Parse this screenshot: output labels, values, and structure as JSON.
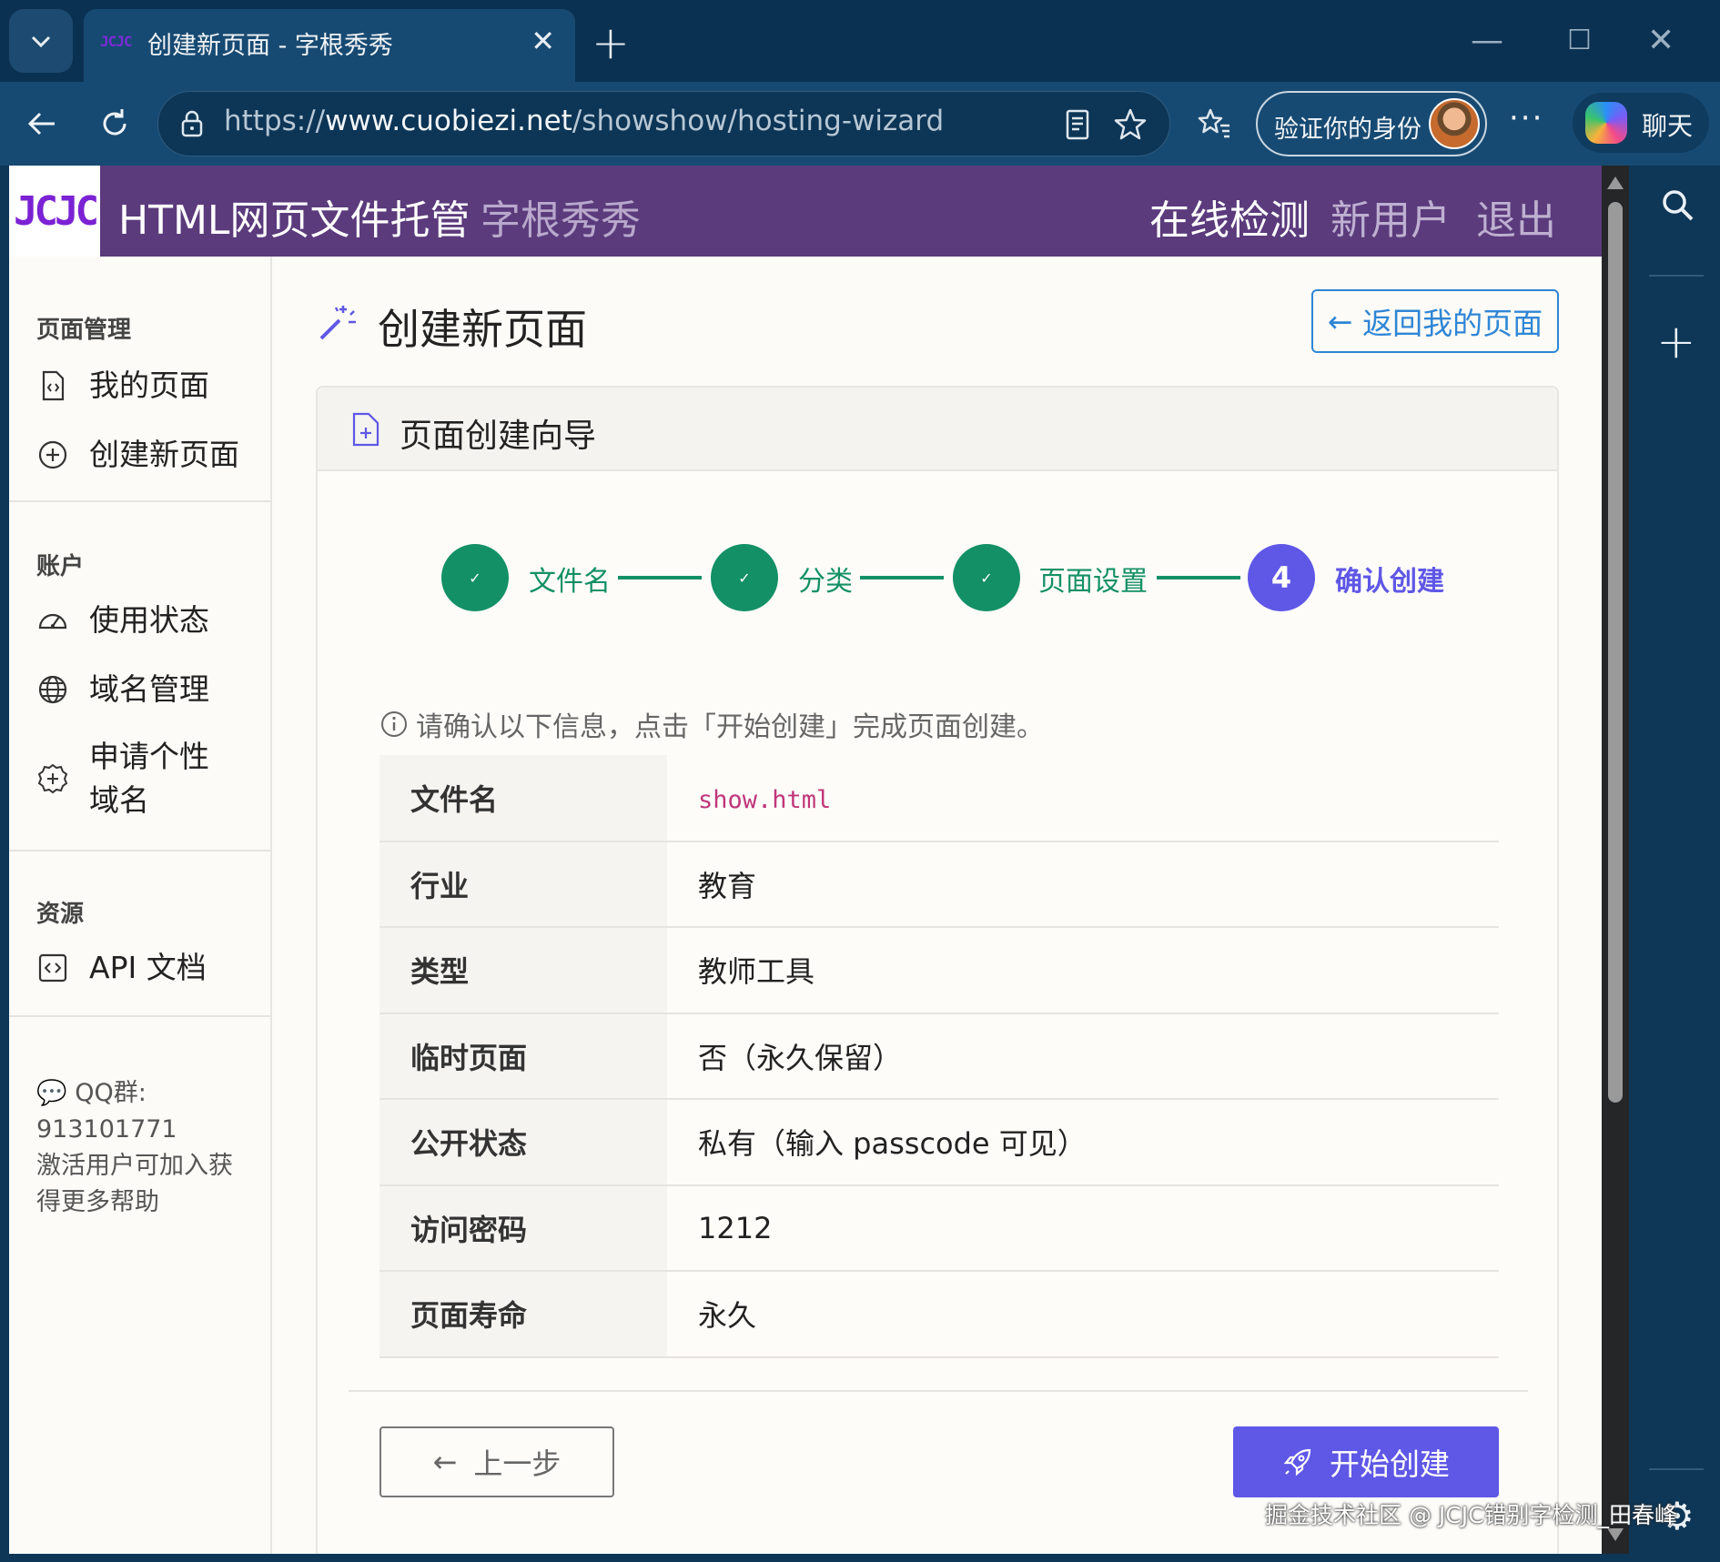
{
  "browser": {
    "tab_title": "创建新页面 - 字根秀秀",
    "tab_favicon": "JCJC",
    "url_scheme": "https://",
    "url_host": "www.cuobiezi.net",
    "url_path": "/showshow/hosting-wizard",
    "verify_label": "验证你的身份",
    "chat_label": "聊天",
    "icons": [
      "tab-list-icon",
      "close-icon",
      "plus-icon",
      "back-arrow-icon",
      "refresh-icon",
      "lock-icon",
      "reader-icon",
      "star-icon",
      "favorites-icon",
      "more-icon",
      "copilot-icon",
      "search-icon",
      "settings-icon"
    ]
  },
  "header": {
    "logo": "JCJC",
    "title": "HTML网页文件托管",
    "subtitle": "字根秀秀",
    "links": [
      "在线检测",
      "新用户",
      "退出"
    ],
    "brand_color": "#5b3b7c"
  },
  "sidebar": {
    "sections": [
      {
        "title": "页面管理",
        "items": [
          {
            "label": "我的页面",
            "icon": "file-code-icon"
          },
          {
            "label": "创建新页面",
            "icon": "plus-circle-icon"
          }
        ]
      },
      {
        "title": "账户",
        "items": [
          {
            "label": "使用状态",
            "icon": "speedometer-icon"
          },
          {
            "label": "域名管理",
            "icon": "globe-icon"
          },
          {
            "label": "申请个性域名",
            "icon": "plus-gear-icon"
          }
        ]
      },
      {
        "title": "资源",
        "items": [
          {
            "label": "API 文档",
            "icon": "code-square-icon"
          }
        ]
      }
    ],
    "qq_label": "QQ群:",
    "qq_number": "913101771",
    "qq_note": "激活用户可加入获得更多帮助"
  },
  "main": {
    "heading": "创建新页面",
    "back_button": "返回我的页面",
    "card_title": "页面创建向导",
    "steps": [
      {
        "label": "文件名",
        "state": "done"
      },
      {
        "label": "分类",
        "state": "done"
      },
      {
        "label": "页面设置",
        "state": "done"
      },
      {
        "label": "确认创建",
        "state": "active",
        "number": "4"
      }
    ],
    "info": "请确认以下信息，点击「开始创建」完成页面创建。",
    "summary": [
      {
        "key": "文件名",
        "value": "show.html"
      },
      {
        "key": "行业",
        "value": "教育"
      },
      {
        "key": "类型",
        "value": "教师工具"
      },
      {
        "key": "临时页面",
        "value": "否（永久保留）"
      },
      {
        "key": "公开状态",
        "value": "私有（输入 passcode 可见）"
      },
      {
        "key": "访问密码",
        "value": "1212"
      },
      {
        "key": "页面寿命",
        "value": "永久"
      }
    ],
    "prev_button": "上一步",
    "create_button": "开始创建",
    "colors": {
      "done": "#149066",
      "active": "#5f57e6",
      "link": "#2f86d6"
    }
  },
  "watermark": "掘金技术社区 @ JCJC错别字检测_田春峰"
}
